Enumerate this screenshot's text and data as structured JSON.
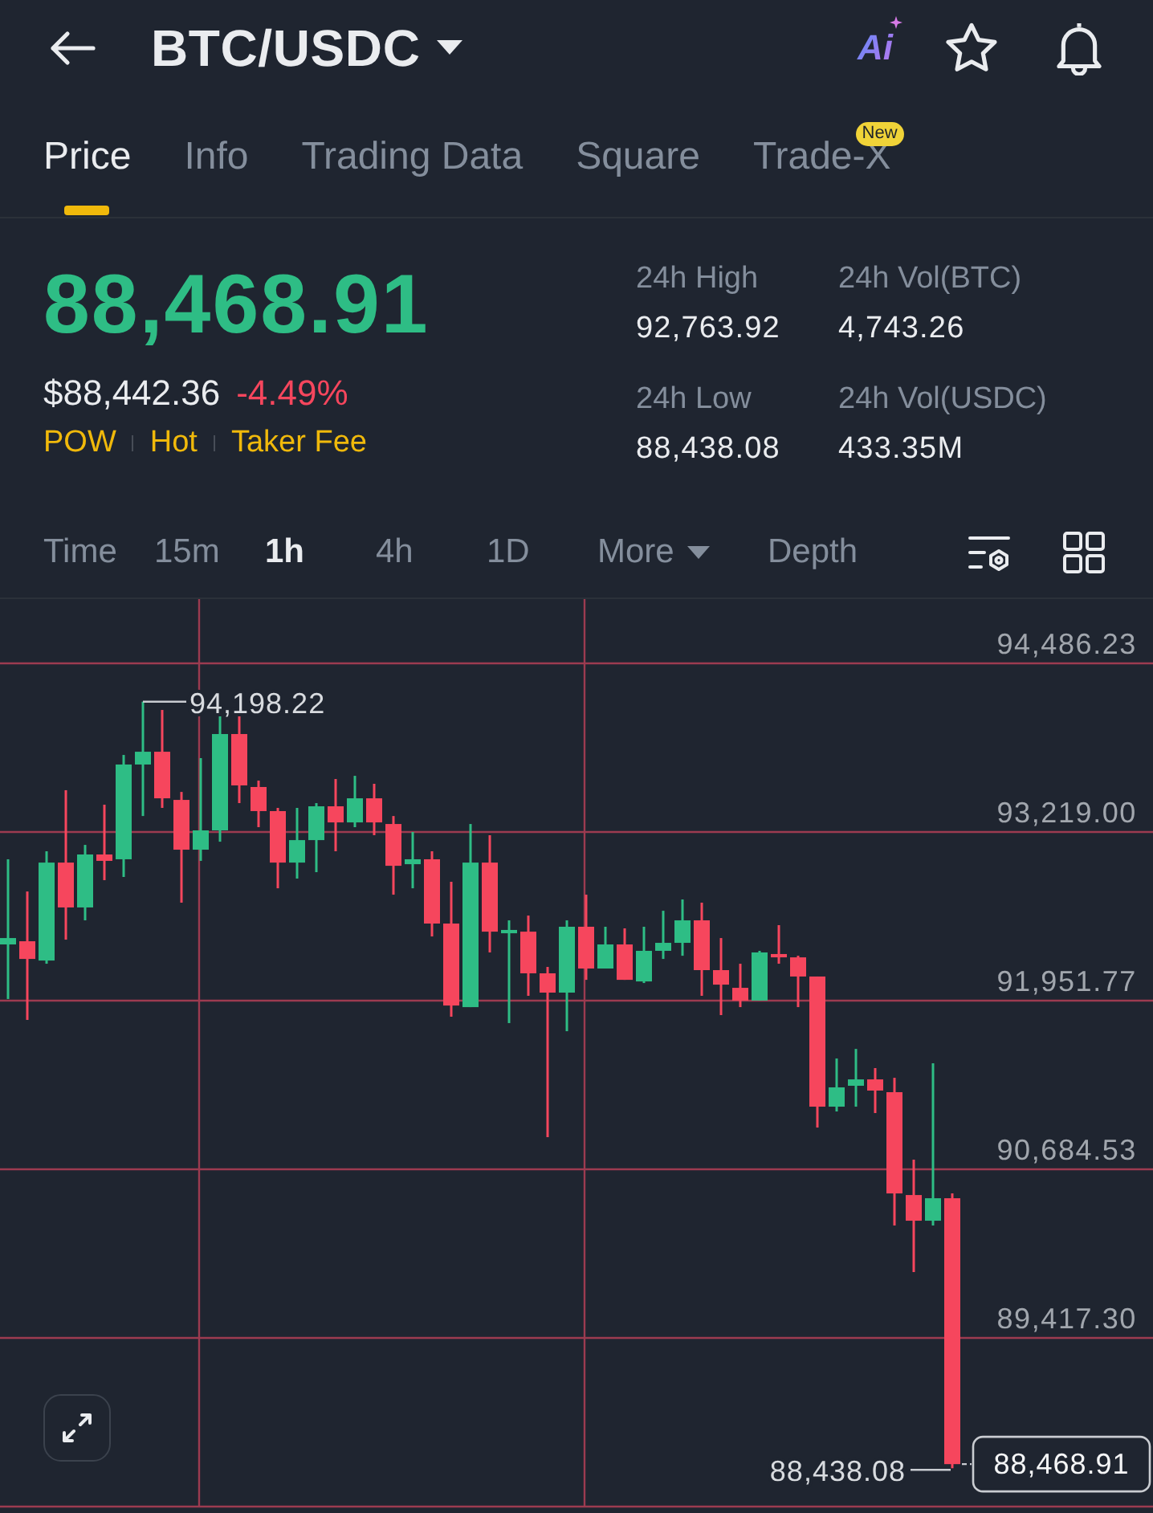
{
  "header": {
    "title": "BTC/USDC",
    "ai_label": "Ai"
  },
  "tabs": [
    {
      "label": "Price",
      "selected": true
    },
    {
      "label": "Info",
      "selected": false
    },
    {
      "label": "Trading Data",
      "selected": false
    },
    {
      "label": "Square",
      "selected": false
    },
    {
      "label": "Trade-X",
      "selected": false,
      "badge": "New"
    }
  ],
  "ticker": {
    "last_price": "88,468.91",
    "usd_price": "$88,442.36",
    "change": "-4.49%",
    "tags": [
      "POW",
      "Hot",
      "Taker Fee"
    ]
  },
  "stats": [
    {
      "label": "24h High",
      "value": "92,763.92"
    },
    {
      "label": "24h Vol(BTC)",
      "value": "4,743.26"
    },
    {
      "label": "24h Low",
      "value": "88,438.08"
    },
    {
      "label": "24h Vol(USDC)",
      "value": "433.35M"
    }
  ],
  "intervals": [
    {
      "label": "Time",
      "kind": "option",
      "selected": false
    },
    {
      "label": "15m",
      "kind": "option",
      "selected": false
    },
    {
      "label": "1h",
      "kind": "option",
      "selected": true
    },
    {
      "label": "4h",
      "kind": "option",
      "selected": false
    },
    {
      "label": "1D",
      "kind": "option",
      "selected": false
    },
    {
      "label": "More",
      "kind": "dropdown",
      "selected": false
    },
    {
      "label": "Depth",
      "kind": "option",
      "selected": false
    }
  ],
  "chart": {
    "chart_data": {
      "type": "candlestick",
      "ohlc": [
        [
          92374,
          93014,
          91964,
          92422
        ],
        [
          92398,
          92772,
          91807,
          92265
        ],
        [
          92253,
          93074,
          92229,
          92989
        ],
        [
          92989,
          93533,
          92410,
          92652
        ],
        [
          92652,
          93122,
          92555,
          93050
        ],
        [
          93050,
          93424,
          92857,
          93002
        ],
        [
          93014,
          93798,
          92881,
          93726
        ],
        [
          93726,
          94198.22,
          93339,
          93822
        ],
        [
          93822,
          94136,
          93400,
          93472
        ],
        [
          93460,
          93520,
          92688,
          93086
        ],
        [
          93086,
          93774,
          93002,
          93231
        ],
        [
          93231,
          94088,
          93146,
          93955
        ],
        [
          93955,
          94100,
          93436,
          93569
        ],
        [
          93557,
          93605,
          93255,
          93376
        ],
        [
          93376,
          93400,
          92796,
          92989
        ],
        [
          92989,
          93400,
          92869,
          93158
        ],
        [
          93158,
          93436,
          92917,
          93412
        ],
        [
          93412,
          93617,
          93074,
          93291
        ],
        [
          93291,
          93641,
          93255,
          93472
        ],
        [
          93472,
          93581,
          93195,
          93291
        ],
        [
          93279,
          93339,
          92748,
          92965
        ],
        [
          92977,
          93219,
          92796,
          93014
        ],
        [
          93014,
          93074,
          92434,
          92531
        ],
        [
          92531,
          92845,
          91831,
          91915
        ],
        [
          91903,
          93279,
          91903,
          92989
        ],
        [
          92989,
          93195,
          92314,
          92470
        ],
        [
          92458,
          92555,
          91783,
          92483
        ],
        [
          92470,
          92591,
          91988,
          92157
        ],
        [
          92157,
          92205,
          90926,
          92012
        ],
        [
          92012,
          92555,
          91722,
          92507
        ],
        [
          92507,
          92748,
          92108,
          92193
        ],
        [
          92193,
          92507,
          92193,
          92374
        ],
        [
          92374,
          92495,
          92108,
          92108
        ],
        [
          92096,
          92507,
          92084,
          92326
        ],
        [
          92326,
          92627,
          92265,
          92386
        ],
        [
          92386,
          92712,
          92289,
          92555
        ],
        [
          92555,
          92688,
          91988,
          92181
        ],
        [
          92181,
          92422,
          91843,
          92072
        ],
        [
          92048,
          92229,
          91903,
          91952
        ],
        [
          91952,
          92326,
          91952,
          92314
        ],
        [
          92302,
          92519,
          92229,
          92277
        ],
        [
          92277,
          92289,
          91903,
          92133
        ],
        [
          92133,
          92133,
          90998,
          91155
        ],
        [
          91155,
          91517,
          91119,
          91300
        ],
        [
          91312,
          91589,
          91155,
          91360
        ],
        [
          91360,
          91445,
          91107,
          91276
        ],
        [
          91264,
          91372,
          90262,
          90503
        ],
        [
          90491,
          90757,
          89912,
          90298
        ],
        [
          90298,
          91481,
          90262,
          90467
        ],
        [
          90467,
          90503,
          88438.08,
          88468.91
        ]
      ],
      "ylim": [
        88150.07,
        94981.0
      ],
      "yticks": [
        {
          "value": 94486.23,
          "label": "94,486.23"
        },
        {
          "value": 93219.0,
          "label": "93,219.00"
        },
        {
          "value": 91951.77,
          "label": "91,951.77"
        },
        {
          "value": 90684.53,
          "label": "90,684.53"
        },
        {
          "value": 89417.3,
          "label": "89,417.30"
        }
      ],
      "grid": true,
      "annotations": [
        "94,198.22",
        "88,438.08",
        "88,468.91"
      ]
    }
  }
}
